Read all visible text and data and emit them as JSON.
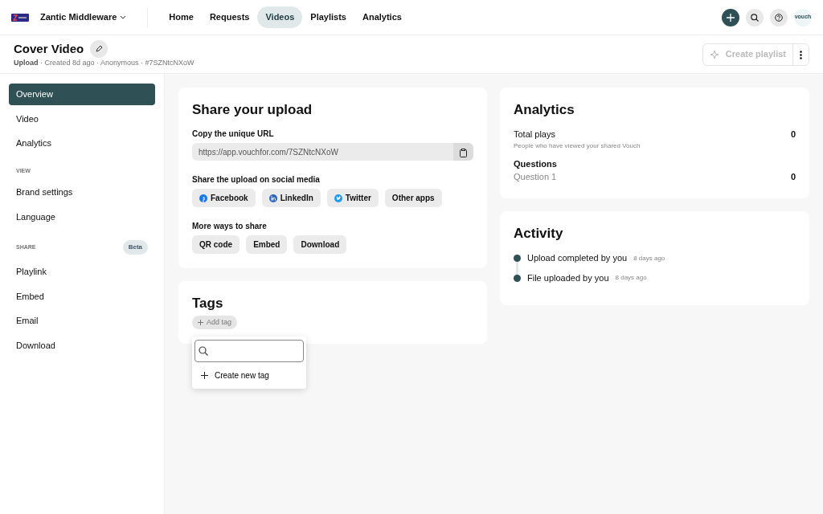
{
  "topbar": {
    "workspace": "Zantic Middleware",
    "nav": [
      {
        "label": "Home",
        "selected": false
      },
      {
        "label": "Requests",
        "selected": false
      },
      {
        "label": "Videos",
        "selected": true
      },
      {
        "label": "Playlists",
        "selected": false
      },
      {
        "label": "Analytics",
        "selected": false
      }
    ],
    "avatar": "vouch"
  },
  "header": {
    "title": "Cover Video",
    "meta": "**Upload** · Created 8d ago · Anonymous · #7SZNtcNXoW",
    "create_button": {
      "label": "Create playlist",
      "disabled": true
    }
  },
  "sidebar": {
    "sections": [
      {
        "items": [
          {
            "label": "Overview",
            "selected": true
          },
          {
            "label": "Video",
            "selected": false
          },
          {
            "label": "Analytics",
            "selected": false
          }
        ]
      },
      {
        "heading": "VIEW",
        "items": [
          {
            "label": "Brand settings",
            "selected": false
          },
          {
            "label": "Language",
            "selected": false
          }
        ]
      },
      {
        "heading": "SHARE",
        "badge": "Beta",
        "items": [
          {
            "label": "Playlink",
            "selected": false
          },
          {
            "label": "Embed",
            "selected": false
          },
          {
            "label": "Email",
            "selected": false
          },
          {
            "label": "Download",
            "selected": false
          }
        ]
      }
    ]
  },
  "share": {
    "title": "Share your upload",
    "url_label": "Copy the unique URL",
    "url": "https://app.vouchfor.com/7SZNtcNXoW",
    "social_label": "Share the upload on social media",
    "social": [
      {
        "label": "Facebook",
        "kind": "facebook"
      },
      {
        "label": "LinkedIn",
        "kind": "linkedin"
      },
      {
        "label": "Twitter",
        "kind": "twitter"
      },
      {
        "label": "Other apps",
        "kind": "plain"
      }
    ],
    "more_label": "More ways to share",
    "more": [
      "QR code",
      "Embed",
      "Download"
    ]
  },
  "tags": {
    "title": "Tags",
    "add_label": "Add tag",
    "dropdown": {
      "create_label": "Create new tag"
    }
  },
  "analytics": {
    "title": "Analytics",
    "rows": [
      {
        "label": "Total plays",
        "sub": "People who have viewed your shared Vouch",
        "value": "0"
      }
    ],
    "questions_label": "Questions",
    "questions": [
      {
        "label": "Question 1",
        "value": "0"
      }
    ]
  },
  "activity": {
    "title": "Activity",
    "items": [
      {
        "text": "Upload completed by you",
        "time": "8 days ago"
      },
      {
        "text": "File uploaded by you",
        "time": "8 days ago"
      }
    ]
  }
}
